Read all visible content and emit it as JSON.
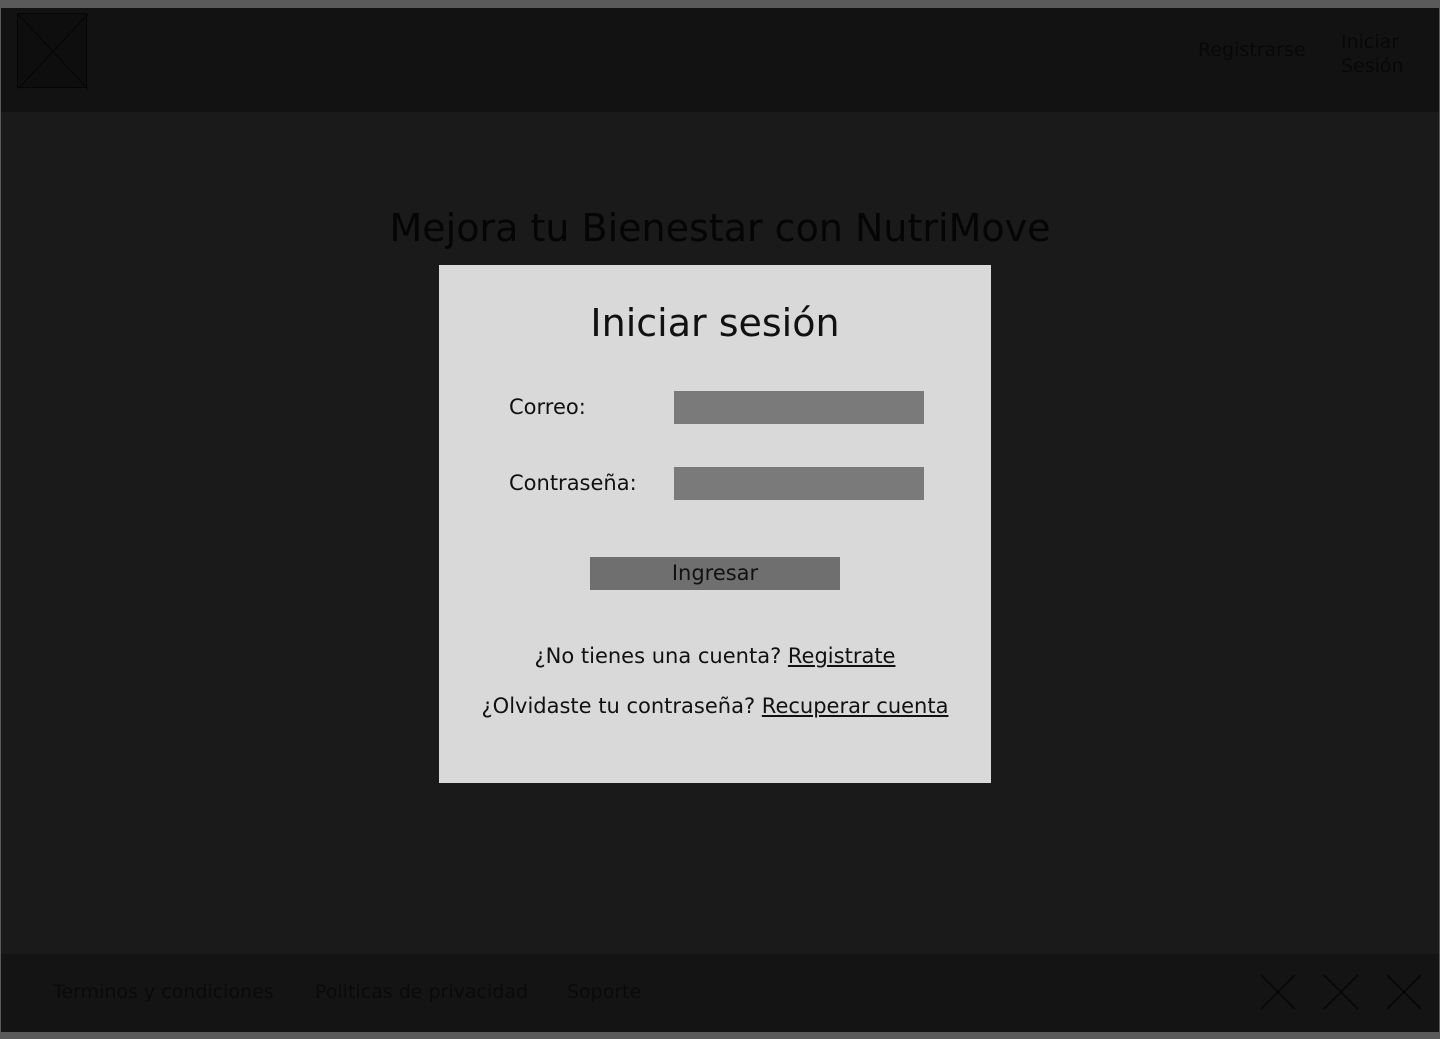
{
  "header": {
    "logo_icon": "image-placeholder-icon",
    "nav": {
      "register_label": "Registrarse",
      "login_line1": "Iniciar",
      "login_line2": "Sesión"
    }
  },
  "hero": {
    "title": "Mejora tu Bienestar con NutriMove"
  },
  "login_modal": {
    "title": "Iniciar sesión",
    "email_label": "Correo:",
    "email_value": "",
    "password_label": "Contraseña:",
    "password_value": "",
    "submit_label": "Ingresar",
    "no_account_text": "¿No tienes una cuenta?",
    "register_link": "Registrate",
    "forgot_text": "¿Olvidaste tu contraseña?",
    "recover_link": "Recuperar cuenta"
  },
  "footer": {
    "links": [
      "Terminos y condiciones",
      "Politicas de privacidad",
      "Soporte"
    ],
    "social_icons": [
      "social-placeholder-icon",
      "social-placeholder-icon",
      "social-placeholder-icon"
    ]
  },
  "colors": {
    "overlay_background": "#1a1a1a",
    "modal_background": "#d9d9d9",
    "input_background": "#7a7a7a",
    "button_background": "#6f6f6f"
  }
}
